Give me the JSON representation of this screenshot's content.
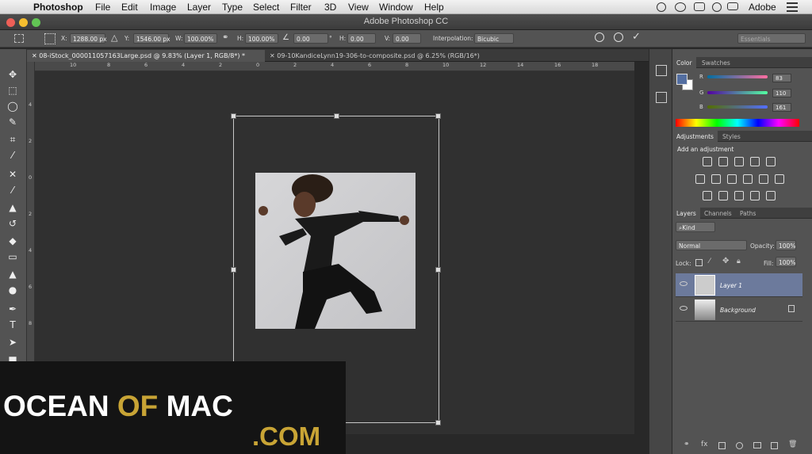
{
  "menubar": {
    "apple": "",
    "app_name": "Photoshop",
    "items": [
      "File",
      "Edit",
      "Image",
      "Layer",
      "Type",
      "Select",
      "Filter",
      "3D",
      "View",
      "Window",
      "Help"
    ],
    "right_label": "Adobe"
  },
  "window": {
    "title": "Adobe Photoshop CC"
  },
  "options_bar": {
    "x_label": "X:",
    "x_value": "1288.00 px",
    "y_label": "Y:",
    "y_value": "1546.00 px",
    "w_label": "W:",
    "w_value": "100.00%",
    "h_label": "H:",
    "h_value": "100.00%",
    "angle_value": "0.00",
    "angle_unit": "°",
    "hskew_label": "H:",
    "hskew_value": "0.00",
    "vskew_label": "V:",
    "vskew_value": "0.00",
    "interp_label": "Interpolation:",
    "interp_value": "Bicubic",
    "workspace": "Essentials"
  },
  "tabs": [
    {
      "label": "08-iStock_000011057163Large.psd @ 9.83% (Layer 1, RGB/8*) *"
    },
    {
      "label": "09-10KandiceLynn19-306-to-composite.psd @ 6.25% (RGB/16*)"
    }
  ],
  "rulers": {
    "h_ticks": [
      "10",
      "8",
      "6",
      "4",
      "2",
      "0",
      "2",
      "4",
      "6",
      "8",
      "10",
      "12",
      "14",
      "16",
      "18"
    ],
    "v_ticks": [
      "4",
      "2",
      "0",
      "2",
      "4",
      "6",
      "8"
    ]
  },
  "color_panel": {
    "tabs": [
      "Color",
      "Swatches"
    ],
    "r_label": "R",
    "r_value": "83",
    "g_label": "G",
    "g_value": "110",
    "b_label": "B",
    "b_value": "161",
    "fg_color": "#536ea1"
  },
  "adjustments_panel": {
    "tabs": [
      "Adjustments",
      "Styles"
    ],
    "heading": "Add an adjustment"
  },
  "layers_panel": {
    "tabs": [
      "Layers",
      "Channels",
      "Paths"
    ],
    "kind_label": "Kind",
    "blend_mode": "Normal",
    "opacity_label": "Opacity:",
    "opacity_value": "100%",
    "lock_label": "Lock:",
    "fill_label": "Fill:",
    "fill_value": "100%",
    "layers": [
      {
        "name": "Layer 1",
        "selected": true
      },
      {
        "name": "Background",
        "selected": false
      }
    ]
  },
  "watermark": {
    "line1_a": "OCEAN",
    "line1_b": "OF",
    "line1_c": "MAC",
    "line2": ".COM"
  },
  "colors": {
    "accent_gold": "#c8a435",
    "selected_layer": "#6c7a9c"
  }
}
